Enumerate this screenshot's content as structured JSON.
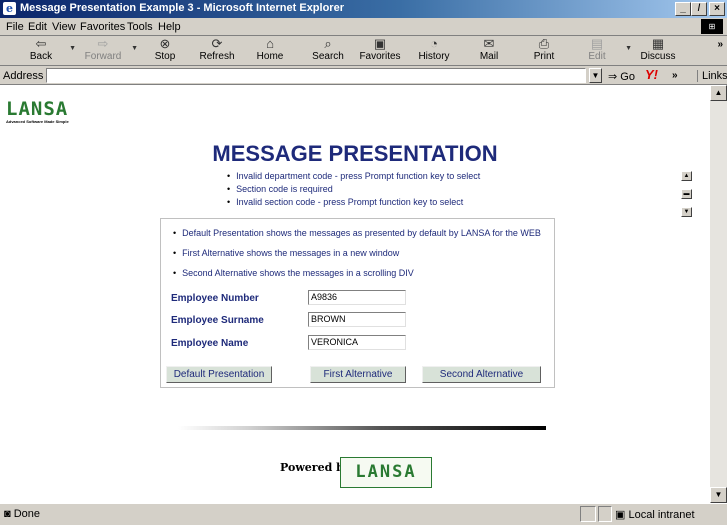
{
  "window": {
    "title": "Message Presentation Example 3 - Microsoft Internet Explorer",
    "min": "_",
    "max": "̸",
    "close": "×"
  },
  "menu": [
    "File",
    "Edit",
    "View",
    "Favorites",
    "Tools",
    "Help"
  ],
  "toolbar": {
    "back": "Back",
    "forward": "Forward",
    "stop": "Stop",
    "refresh": "Refresh",
    "home": "Home",
    "search": "Search",
    "favorites": "Favorites",
    "history": "History",
    "mail": "Mail",
    "print": "Print",
    "edit": "Edit",
    "discuss": "Discuss",
    "more": "»"
  },
  "address": {
    "label": "Address",
    "value": "",
    "go": "Go",
    "links": "Links",
    "more": "»"
  },
  "page": {
    "logo_letters": "LANSA",
    "logo_tagline": "Advanced Software Made Simple",
    "title": "MESSAGE PRESENTATION",
    "errors": [
      "Invalid department code - press Prompt function key to select",
      "Section code is required",
      "Invalid section code - press Prompt function key to select"
    ],
    "info": [
      "Default Presentation shows the messages as presented by default by LANSA for the WEB",
      "First Alternative shows the messages in a new window",
      "Second Alternative shows the messages in a scrolling DIV"
    ],
    "fields": {
      "employee_number": {
        "label": "Employee Number",
        "value": "A9836"
      },
      "employee_surname": {
        "label": "Employee Surname",
        "value": "BROWN"
      },
      "employee_name": {
        "label": "Employee Name",
        "value": "VERONICA"
      }
    },
    "buttons": {
      "default": "Default Presentation",
      "first": "First Alternative",
      "second": "Second Alternative"
    },
    "powered_by": "Powered by",
    "powered_logo": "LANSA"
  },
  "status": {
    "text": "Done",
    "zone": "Local intranet"
  }
}
